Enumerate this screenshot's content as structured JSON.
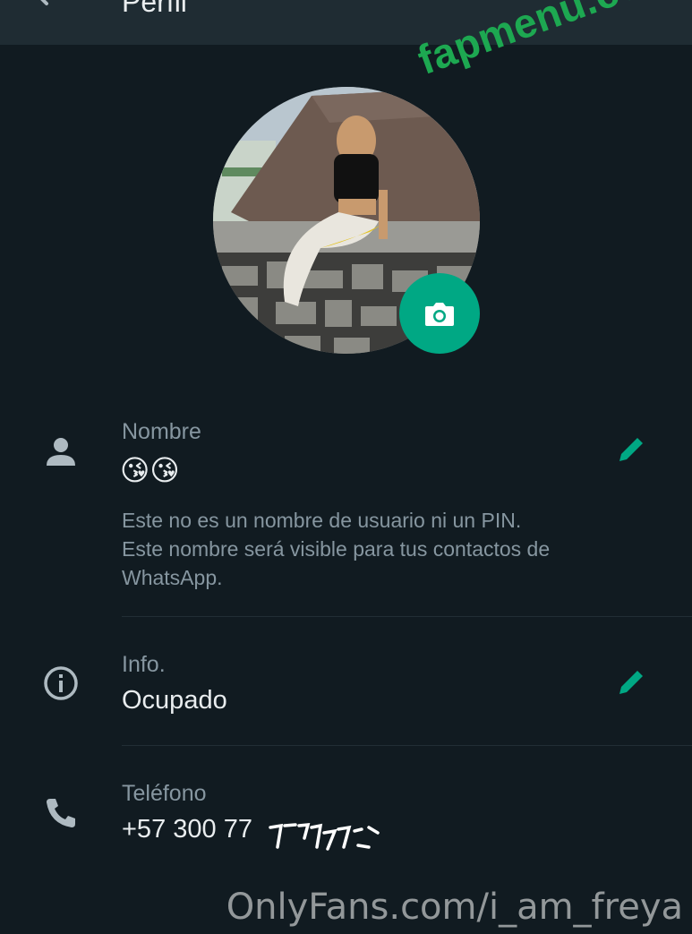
{
  "appbar": {
    "title": "Perfil"
  },
  "watermark_top": "fapmenu.com",
  "profile": {
    "name": {
      "label": "Nombre",
      "value": "😘😘"
    },
    "hint": [
      "Este no es un nombre de usuario ni un PIN.",
      "Este nombre será visible para tus contactos de",
      "WhatsApp."
    ],
    "info": {
      "label": "Info.",
      "value": "Ocupado"
    },
    "phone": {
      "label": "Teléfono",
      "value": "+57 300 77"
    }
  },
  "watermark_bottom": "OnlyFans.com/i_am_freya",
  "colors": {
    "accent": "#00a884",
    "background": "#111b21",
    "appbar": "#1f2c33",
    "secondary_text": "#8696a0"
  }
}
